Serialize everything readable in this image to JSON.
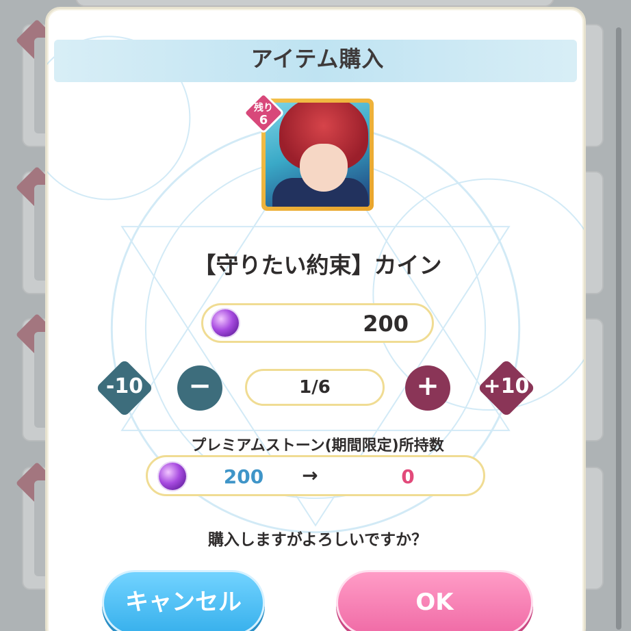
{
  "dialog": {
    "title": "アイテム購入",
    "card": {
      "remaining_label": "残り",
      "remaining_count": "6"
    },
    "item_name": "【守りたい約束】カイン",
    "price": "200",
    "quantity": {
      "minus10_label": "-10",
      "minus_label": "−",
      "value": "1/6",
      "plus_label": "+",
      "plus10_label": "+10"
    },
    "holding": {
      "label": "プレミアムストーン(期間限定)所持数",
      "from": "200",
      "arrow": "→",
      "to": "0"
    },
    "confirm_text": "購入しますがよろしいですか？",
    "cancel_label": "キャンセル",
    "ok_label": "OK"
  },
  "colors": {
    "minus_button": "#3d6d7c",
    "plus_button": "#8a3557",
    "cancel_button": "#37b0ec",
    "ok_button": "#f06ba6",
    "holding_from": "#3f95c8",
    "holding_to": "#e24a7a"
  }
}
